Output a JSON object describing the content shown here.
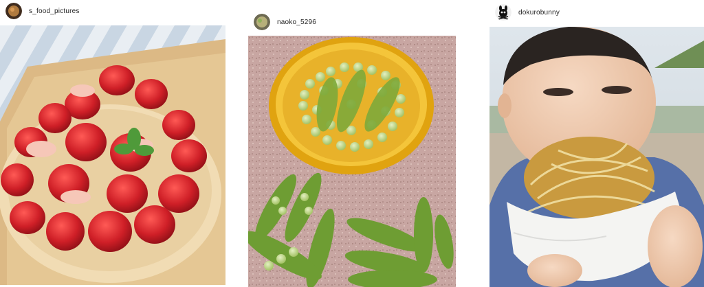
{
  "posts": [
    {
      "username": "s_food_pictures",
      "avatar_icon": "tart-avatar-icon",
      "photo": "strawberry-tart-photo"
    },
    {
      "username": "naoko_5296",
      "avatar_icon": "peas-avatar-icon",
      "photo": "sugar-snap-peas-photo"
    },
    {
      "username": "dokurobunny",
      "avatar_icon": "skull-bunny-avatar-icon",
      "photo": "child-eating-tempura-photo"
    }
  ],
  "colors": {
    "username_text": "#262626",
    "strawberry": "#c8202a",
    "pea_green": "#93bb4e",
    "bowl_yellow": "#f1b820"
  }
}
